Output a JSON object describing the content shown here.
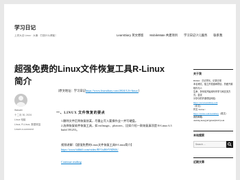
{
  "site": {
    "title": "学习日记",
    "description": "上完大法 Linux · 大事 · 打造什么博客！"
  },
  "nav": {
    "items": [
      "LearnDiary 英文博客",
      "MobileMate 共建项目",
      "学习日记少儿服务",
      "联系我"
    ]
  },
  "post": {
    "title": "超强免费的Linux文件恢复工具R-Linux简介",
    "meta": {
      "author": "Wasabi",
      "date": "十二月 30, 2024",
      "category_1": "Linux 电脑",
      "category_2": "Linux, R-Linux, 数据恢复",
      "comment": "Leave a comment"
    },
    "intro_prefix": "（原文地址：学习日记",
    "intro_link": "https://www.learndiary.com/2024/12/r-linux/",
    "intro_suffix": "）",
    "section_heading": "一、LINUX 文件恢复的要点",
    "list_item_1": "1.删除文件后到恢复前某，尽量止写入要操作业一并写硬盘。",
    "list_item_2": "2.选择恢复软件恢复工具，如 extlmagic、photorec、比如介绍一款恢复真项是 R-Linux 6.3 build 391253。",
    "video_label": "视频讲解：【超强免费的Linux文件恢复工具R-Linux简介】",
    "video_link": "https://www.bilibili.com/video/BV1nJ6SY8ZKK/",
    "read_more": "Continue reading"
  },
  "sidebar": {
    "about_title": "关于我",
    "about_line_1": "Bilibili：日记学长，记录日常",
    "about_line_2": "本名博文，独立开发面网项目，热爱开源软件与人",
    "about_line_3": "生命，多年前开始用写作学习和交流方式，尝试",
    "about_line_4": "分享中的开源项目网站：",
    "about_link_1": "https://www.learndiary.com",
    "about_line_5": "（中文）",
    "about_line_6": "作文 Twitter：",
    "about_link_2": "https://twitter.com/learndiary",
    "about_line_7": "（英文）",
    "about_line_8": "我的邮箱：",
    "about_email": "dashing.meng(AT)gmail(DOT)com",
    "search_title": "本站搜索",
    "search_placeholder": "Search ...",
    "recent_title": "近期文章"
  },
  "colors": {
    "link": "#007acc",
    "text": "#1a1a1a",
    "muted": "#686868",
    "background": "#e8e8e8"
  }
}
